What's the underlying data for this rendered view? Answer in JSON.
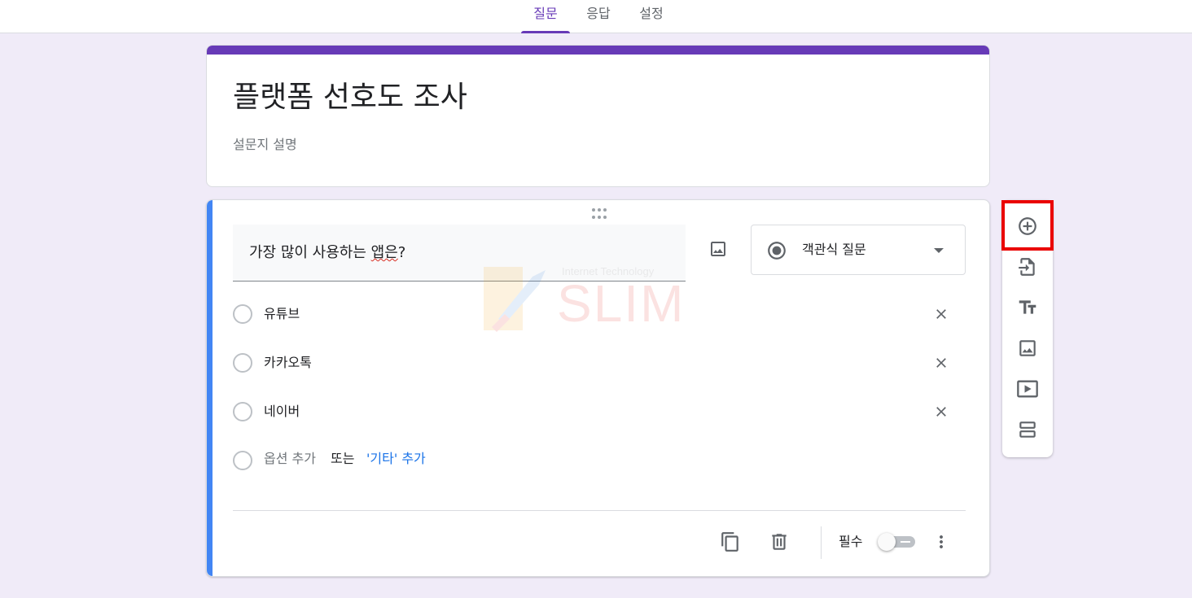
{
  "tabs": [
    {
      "label": "질문",
      "active": true
    },
    {
      "label": "응답",
      "active": false
    },
    {
      "label": "설정",
      "active": false
    }
  ],
  "form": {
    "title": "플랫폼 선호도 조사",
    "description_placeholder": "설문지 설명"
  },
  "question": {
    "text_main": "가장 많이 사용하는 ",
    "text_squiggle": "앱은",
    "text_end": "?",
    "type_label": "객관식 질문",
    "options": [
      "유튜브",
      "카카오톡",
      "네이버"
    ],
    "add_option_label": "옵션 추가",
    "or_label": "또는",
    "add_other_label": "'기타' 추가",
    "required_label": "필수",
    "required": false
  },
  "watermark": {
    "small_text": "Internet Technology",
    "big_text": "SLIM"
  },
  "toolbar": {
    "items": [
      "add-question",
      "import-questions",
      "add-title",
      "add-image",
      "add-video",
      "add-section"
    ]
  },
  "colors": {
    "accent": "#673ab7",
    "active_question": "#4285f4",
    "link": "#1a73e8",
    "highlight": "#ea0000",
    "background": "#f0ebf8"
  }
}
